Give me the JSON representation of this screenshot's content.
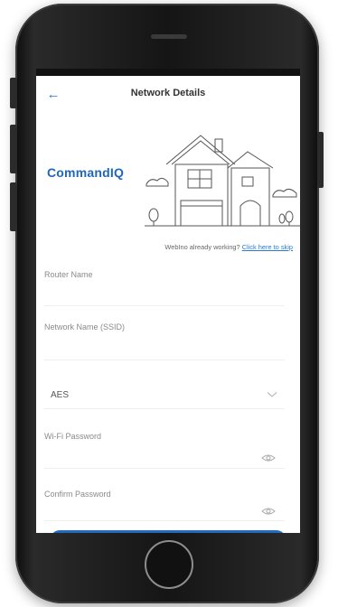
{
  "header": {
    "back_icon": "arrow-left-icon",
    "title": "Network Details"
  },
  "brand": {
    "name": "CommandIQ",
    "color": "#1f67b8"
  },
  "skip": {
    "prompt": "WebIno already working?",
    "link": "Click here to skip"
  },
  "form": {
    "router_name_label": "Router Name",
    "network_name_label": "Network Name (SSID)",
    "security_value": "AES",
    "security_icon": "chevron-down-icon",
    "wifi_password_label": "Wi-Fi Password",
    "confirm_password_label": "Confirm Password",
    "password_icon": "eye-icon"
  },
  "colors": {
    "accent": "#2a7bd1",
    "button": "#1e6cc1",
    "phone_body": "#151515"
  }
}
